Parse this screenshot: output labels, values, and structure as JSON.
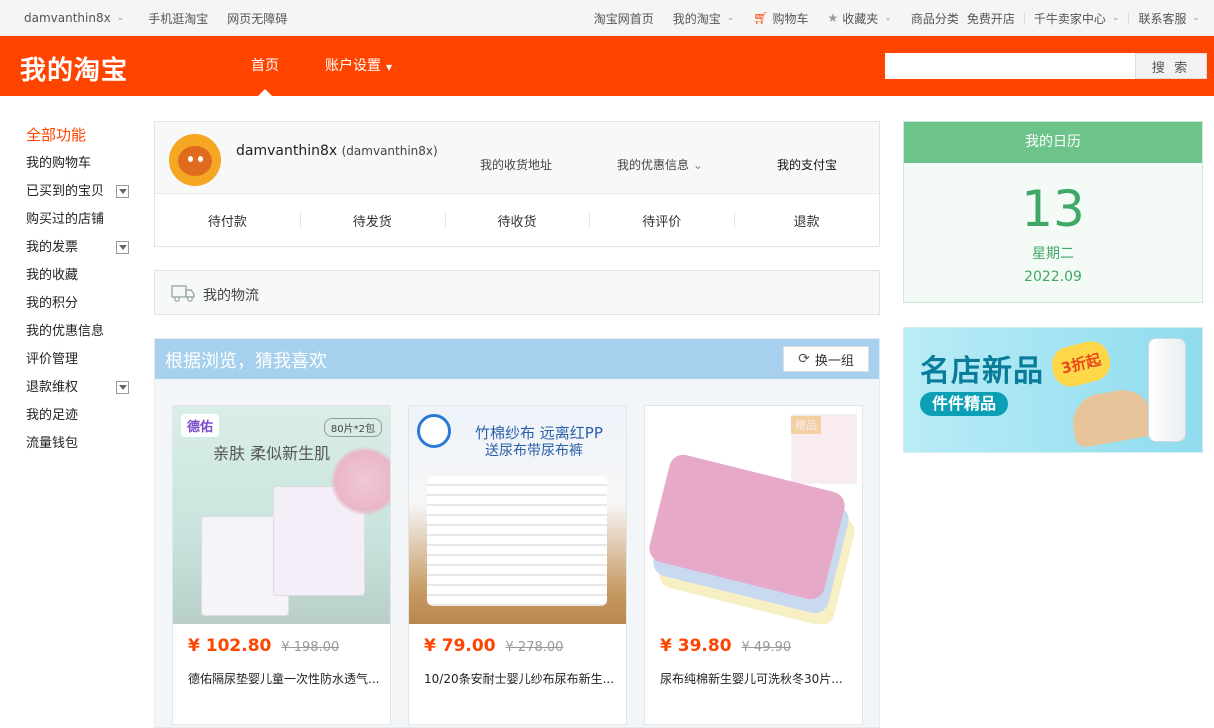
{
  "site_bar": {
    "username": "damvanthin8x",
    "mobile": "手机逛淘宝",
    "accessible": "网页无障碍",
    "home": "淘宝网首页",
    "my_taobao": "我的淘宝",
    "cart": "购物车",
    "favorites": "收藏夹",
    "categories": "商品分类",
    "open_shop": "免费开店",
    "seller_center": "千牛卖家中心",
    "contact": "联系客服"
  },
  "header": {
    "logo": "我的淘宝",
    "nav": [
      "首页",
      "账户设置"
    ],
    "search_placeholder": "",
    "search_button": "搜 索"
  },
  "sidebar": {
    "title": "全部功能",
    "items": [
      "我的购物车",
      "已买到的宝贝",
      "购买过的店铺",
      "我的发票",
      "我的收藏",
      "我的积分",
      "我的优惠信息",
      "评价管理",
      "退款维权",
      "我的足迹",
      "流量钱包"
    ]
  },
  "user_panel": {
    "name": "damvanthin8x",
    "name_sub": "(damvanthin8x)",
    "address": "我的收货地址",
    "coupons": "我的优惠信息",
    "alipay": "我的支付宝",
    "orders": [
      "待付款",
      "待发货",
      "待收货",
      "待评价",
      "退款"
    ]
  },
  "logistics": {
    "label": "我的物流"
  },
  "recommend": {
    "title": "根据浏览，猜我喜欢",
    "refresh": "换一组",
    "products": [
      {
        "price": "¥ 102.80",
        "old_price": "¥ 198.00",
        "title": "德佑隔尿垫婴儿童一次性防水透气...",
        "img_brand": "德佑",
        "img_count": "80片*2包",
        "img_caption": "亲肤 柔似新生肌"
      },
      {
        "price": "¥ 79.00",
        "old_price": "¥ 278.00",
        "title": "10/20条安耐士婴儿纱布尿布新生...",
        "img_caption": "竹棉纱布 远离红PP",
        "img_caption2": "送尿布带尿布裤"
      },
      {
        "price": "¥ 39.80",
        "old_price": "¥ 49.90",
        "title": "尿布纯棉新生婴儿可洗秋冬30片...",
        "img_tag": "赠品"
      }
    ]
  },
  "calendar": {
    "title": "我的日历",
    "day": "13",
    "weekday": "星期二",
    "month": "2022.09"
  },
  "ad": {
    "headline": "名店新品",
    "subline": "件件精品",
    "badge": "3折起"
  },
  "colors": {
    "brand": "#ff4400",
    "calendar": "#6dc48a",
    "recommend_head": "#a6d0ee"
  }
}
